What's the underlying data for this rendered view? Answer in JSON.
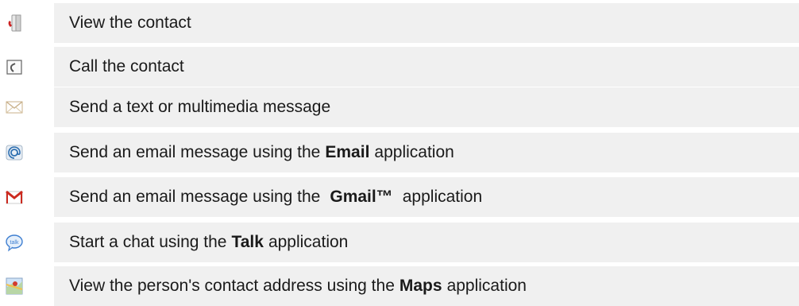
{
  "rows": [
    {
      "icon": "contact-card-icon",
      "before": "View the contact",
      "app": "",
      "after": ""
    },
    {
      "icon": "phone-call-icon",
      "before": "Call the contact",
      "app": "",
      "after": ""
    },
    {
      "icon": "envelope-icon",
      "before": "Send a text or multimedia message",
      "app": "",
      "after": ""
    },
    {
      "icon": "email-at-icon",
      "before": "Send an email message using the",
      "app": "Email",
      "after": "application"
    },
    {
      "icon": "gmail-icon",
      "before": "Send an email message using the",
      "app": "Gmail™",
      "after": "application"
    },
    {
      "icon": "talk-icon",
      "before": "Start a chat using the",
      "app": "Talk",
      "after": "application"
    },
    {
      "icon": "maps-icon",
      "before": "View the person's contact address using the",
      "app": "Maps",
      "after": "application"
    }
  ],
  "colors": {
    "row_background": "#f0f0f0",
    "text": "#1a1a1a",
    "gmail_red": "#cc2a1f",
    "talk_blue": "#3f7fd1"
  }
}
